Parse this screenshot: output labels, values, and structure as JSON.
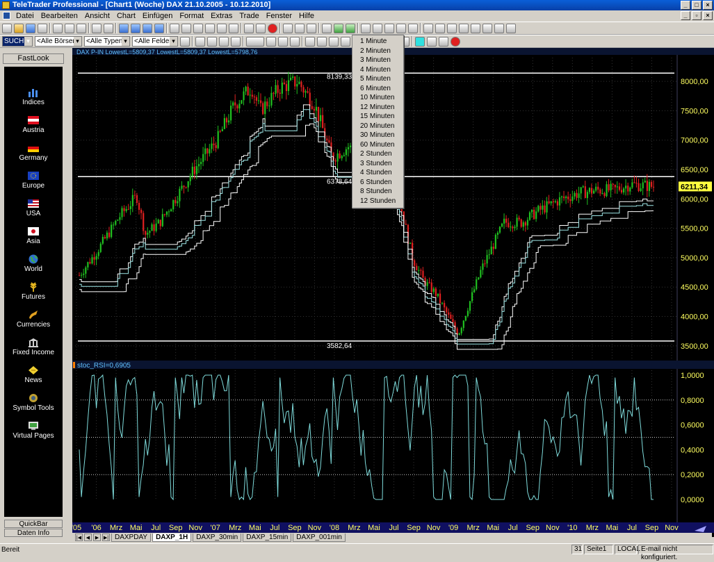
{
  "window": {
    "title": "TeleTrader Professional - [Chart1 (Woche)  DAX 21.10.2005 - 10.12.2010]"
  },
  "menu": [
    "Datei",
    "Bearbeiten",
    "Ansicht",
    "Chart",
    "Einfügen",
    "Format",
    "Extras",
    "Trade",
    "Fenster",
    "Hilfe"
  ],
  "toolbar2": {
    "search": "SUCHE>",
    "boersen": "<Alle Börsen>",
    "typen": "<Alle Typen>",
    "felder": "<Alle Felder>"
  },
  "fastlook": {
    "header": "FastLook",
    "items": [
      {
        "label": "Indices",
        "icon": "chart-bars-icon"
      },
      {
        "label": "Austria",
        "icon": "austria-flag-icon"
      },
      {
        "label": "Germany",
        "icon": "germany-flag-icon"
      },
      {
        "label": "Europe",
        "icon": "eu-flag-icon"
      },
      {
        "label": "USA",
        "icon": "usa-flag-icon"
      },
      {
        "label": "Asia",
        "icon": "japan-flag-icon"
      },
      {
        "label": "World",
        "icon": "globe-icon"
      },
      {
        "label": "Futures",
        "icon": "wheat-icon"
      },
      {
        "label": "Currencies",
        "icon": "horn-icon"
      },
      {
        "label": "Fixed Income",
        "icon": "bank-icon"
      },
      {
        "label": "News",
        "icon": "news-icon"
      },
      {
        "label": "Symbol Tools",
        "icon": "tools-icon"
      },
      {
        "label": "Virtual Pages",
        "icon": "screen-icon"
      }
    ],
    "quickbar": "QuickBar",
    "dateninfo": "Daten Info"
  },
  "interval_menu": [
    "1 Minute",
    "2 Minuten",
    "3 Minuten",
    "4 Minuten",
    "5 Minuten",
    "6 Minuten",
    "10 Minuten",
    "12 Minuten",
    "15 Minuten",
    "20 Minuten",
    "30 Minuten",
    "60 Minuten",
    "2 Stunden",
    "3 Stunden",
    "4 Stunden",
    "6 Stunden",
    "8 Stunden",
    "12 Stunden"
  ],
  "chart_data": [
    {
      "type": "candlestick",
      "legend": "DAX P-IN  LowestL=5809,37  LowestL=5809,37  LowestL=5798,76",
      "yticks": [
        "8000,00",
        "7500,00",
        "7000,00",
        "6500,00",
        "6000,00",
        "5500,00",
        "5000,00",
        "4500,00",
        "4000,00",
        "3500,00"
      ],
      "ylim": [
        3250,
        8450
      ],
      "last_price": "6211,34",
      "hlines": [
        {
          "value": 8139.33,
          "label": "8139,33"
        },
        {
          "value": 6378.64,
          "label": "6378,64"
        },
        {
          "value": 3582.64,
          "label": "3582,64"
        }
      ],
      "x_labels": [
        "'05",
        "'06",
        "Mrz",
        "Mai",
        "Jul",
        "Sep",
        "Nov",
        "'07",
        "Mrz",
        "Mai",
        "Jul",
        "Sep",
        "Nov",
        "'08",
        "Mrz",
        "Mai",
        "Jul",
        "Sep",
        "Nov",
        "'09",
        "Mrz",
        "Mai",
        "Jul",
        "Sep",
        "Nov",
        "'10",
        "Mrz",
        "Mai",
        "Jul",
        "Sep",
        "Nov"
      ],
      "colors": {
        "up": "#20c020",
        "down": "#e02020",
        "channel": "#ffffff",
        "channel2": "#9ee7e7"
      }
    },
    {
      "type": "line",
      "legend": "stoc_RSI=0,6905",
      "yticks": [
        "1,0000",
        "0,8000",
        "0,6000",
        "0,4000",
        "0,2000",
        "0,0000"
      ],
      "ylim": [
        0,
        1.05
      ],
      "dotted_levels": [
        0.8,
        0.5,
        0.2
      ],
      "color": "#7fdcdc"
    }
  ],
  "tabs": [
    "DAXPDAY",
    "DAXP_1H",
    "DAXP_30min",
    "DAXP_15min",
    "DAXP_001min"
  ],
  "active_tab": "DAXP_1H",
  "status": {
    "left": "Bereit",
    "page_num": "31",
    "page": "Seite1",
    "mode": "LOCAL",
    "email": "E-mail nicht konfiguriert."
  }
}
